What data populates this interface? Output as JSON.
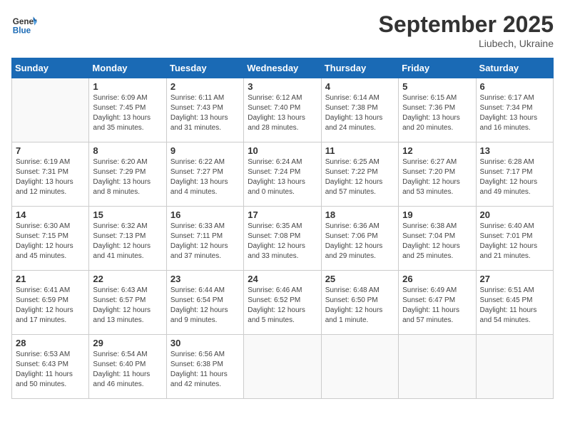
{
  "logo": {
    "line1": "General",
    "line2": "Blue"
  },
  "title": "September 2025",
  "subtitle": "Liubech, Ukraine",
  "weekdays": [
    "Sunday",
    "Monday",
    "Tuesday",
    "Wednesday",
    "Thursday",
    "Friday",
    "Saturday"
  ],
  "weeks": [
    [
      {
        "day": "",
        "empty": true
      },
      {
        "day": "1",
        "sunrise": "6:09 AM",
        "sunset": "7:45 PM",
        "daylight": "13 hours and 35 minutes."
      },
      {
        "day": "2",
        "sunrise": "6:11 AM",
        "sunset": "7:43 PM",
        "daylight": "13 hours and 31 minutes."
      },
      {
        "day": "3",
        "sunrise": "6:12 AM",
        "sunset": "7:40 PM",
        "daylight": "13 hours and 28 minutes."
      },
      {
        "day": "4",
        "sunrise": "6:14 AM",
        "sunset": "7:38 PM",
        "daylight": "13 hours and 24 minutes."
      },
      {
        "day": "5",
        "sunrise": "6:15 AM",
        "sunset": "7:36 PM",
        "daylight": "13 hours and 20 minutes."
      },
      {
        "day": "6",
        "sunrise": "6:17 AM",
        "sunset": "7:34 PM",
        "daylight": "13 hours and 16 minutes."
      }
    ],
    [
      {
        "day": "7",
        "sunrise": "6:19 AM",
        "sunset": "7:31 PM",
        "daylight": "13 hours and 12 minutes."
      },
      {
        "day": "8",
        "sunrise": "6:20 AM",
        "sunset": "7:29 PM",
        "daylight": "13 hours and 8 minutes."
      },
      {
        "day": "9",
        "sunrise": "6:22 AM",
        "sunset": "7:27 PM",
        "daylight": "13 hours and 4 minutes."
      },
      {
        "day": "10",
        "sunrise": "6:24 AM",
        "sunset": "7:24 PM",
        "daylight": "13 hours and 0 minutes."
      },
      {
        "day": "11",
        "sunrise": "6:25 AM",
        "sunset": "7:22 PM",
        "daylight": "12 hours and 57 minutes."
      },
      {
        "day": "12",
        "sunrise": "6:27 AM",
        "sunset": "7:20 PM",
        "daylight": "12 hours and 53 minutes."
      },
      {
        "day": "13",
        "sunrise": "6:28 AM",
        "sunset": "7:17 PM",
        "daylight": "12 hours and 49 minutes."
      }
    ],
    [
      {
        "day": "14",
        "sunrise": "6:30 AM",
        "sunset": "7:15 PM",
        "daylight": "12 hours and 45 minutes."
      },
      {
        "day": "15",
        "sunrise": "6:32 AM",
        "sunset": "7:13 PM",
        "daylight": "12 hours and 41 minutes."
      },
      {
        "day": "16",
        "sunrise": "6:33 AM",
        "sunset": "7:11 PM",
        "daylight": "12 hours and 37 minutes."
      },
      {
        "day": "17",
        "sunrise": "6:35 AM",
        "sunset": "7:08 PM",
        "daylight": "12 hours and 33 minutes."
      },
      {
        "day": "18",
        "sunrise": "6:36 AM",
        "sunset": "7:06 PM",
        "daylight": "12 hours and 29 minutes."
      },
      {
        "day": "19",
        "sunrise": "6:38 AM",
        "sunset": "7:04 PM",
        "daylight": "12 hours and 25 minutes."
      },
      {
        "day": "20",
        "sunrise": "6:40 AM",
        "sunset": "7:01 PM",
        "daylight": "12 hours and 21 minutes."
      }
    ],
    [
      {
        "day": "21",
        "sunrise": "6:41 AM",
        "sunset": "6:59 PM",
        "daylight": "12 hours and 17 minutes."
      },
      {
        "day": "22",
        "sunrise": "6:43 AM",
        "sunset": "6:57 PM",
        "daylight": "12 hours and 13 minutes."
      },
      {
        "day": "23",
        "sunrise": "6:44 AM",
        "sunset": "6:54 PM",
        "daylight": "12 hours and 9 minutes."
      },
      {
        "day": "24",
        "sunrise": "6:46 AM",
        "sunset": "6:52 PM",
        "daylight": "12 hours and 5 minutes."
      },
      {
        "day": "25",
        "sunrise": "6:48 AM",
        "sunset": "6:50 PM",
        "daylight": "12 hours and 1 minute."
      },
      {
        "day": "26",
        "sunrise": "6:49 AM",
        "sunset": "6:47 PM",
        "daylight": "11 hours and 57 minutes."
      },
      {
        "day": "27",
        "sunrise": "6:51 AM",
        "sunset": "6:45 PM",
        "daylight": "11 hours and 54 minutes."
      }
    ],
    [
      {
        "day": "28",
        "sunrise": "6:53 AM",
        "sunset": "6:43 PM",
        "daylight": "11 hours and 50 minutes."
      },
      {
        "day": "29",
        "sunrise": "6:54 AM",
        "sunset": "6:40 PM",
        "daylight": "11 hours and 46 minutes."
      },
      {
        "day": "30",
        "sunrise": "6:56 AM",
        "sunset": "6:38 PM",
        "daylight": "11 hours and 42 minutes."
      },
      {
        "day": "",
        "empty": true
      },
      {
        "day": "",
        "empty": true
      },
      {
        "day": "",
        "empty": true
      },
      {
        "day": "",
        "empty": true
      }
    ]
  ]
}
